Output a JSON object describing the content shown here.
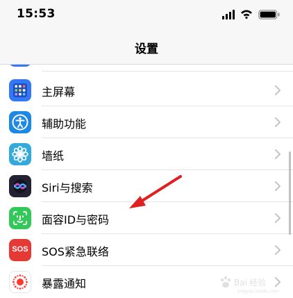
{
  "status_bar": {
    "time": "15:53"
  },
  "nav": {
    "title": "设置"
  },
  "rows": [
    {
      "label": "主屏幕",
      "icon": "home-screen-icon",
      "color": "#3478f6"
    },
    {
      "label": "辅助功能",
      "icon": "accessibility-icon",
      "color": "#1e88e5"
    },
    {
      "label": "墙纸",
      "icon": "wallpaper-icon",
      "color": "#34aadc"
    },
    {
      "label": "Siri与搜索",
      "icon": "siri-icon",
      "color": "#222233"
    },
    {
      "label": "面容ID与密码",
      "icon": "face-id-icon",
      "color": "#34c759"
    },
    {
      "label": "SOS紧急联络",
      "icon": "sos-icon",
      "color": "#e53935",
      "icon_text": "SOS"
    },
    {
      "label": "暴露通知",
      "icon": "exposure-notification-icon",
      "color": "#ffffff"
    }
  ],
  "watermark": {
    "text": "Baidu经验",
    "sub": "jingyan.baidu.com"
  },
  "colors": {
    "accent": "#3478f6",
    "arrow": "#e02020"
  }
}
